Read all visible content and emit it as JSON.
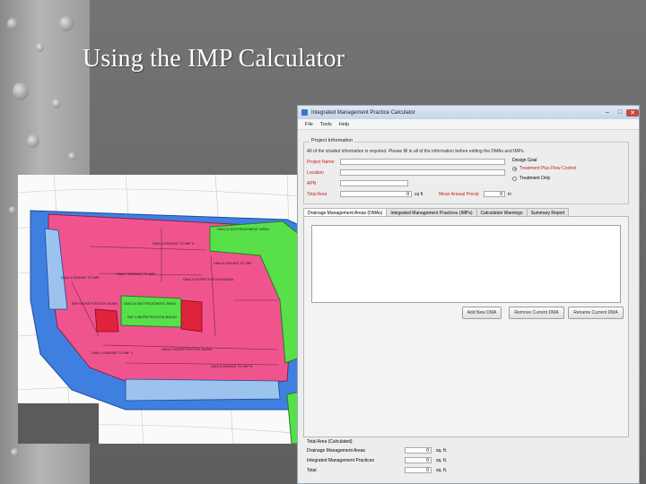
{
  "slide": {
    "title": "Using the IMP Calculator"
  },
  "map": {
    "labels": [
      "DMA 11 BIOTREATMENT AREA",
      "DMA 5 DRAINS TO IMP 5",
      "DMA 6 DRAINS TO IMP",
      "DMA 4 BIORETENTION BASIN",
      "DMA 3 DRAINS TO IMP",
      "DMA 7 DRAINS TO IMP",
      "DMA 10 BIOTREATMENT AREA",
      "IMP BIORETENTION BASIN",
      "IMP 3 BIORETENTION BASIN",
      "DMA 2 BIORETENTION BASIN",
      "DMA 8 DRAINS TO IMP 8",
      "DMA 1 DRAINS TO IMP 1"
    ]
  },
  "window": {
    "title": "Integrated Management Practice Calculator",
    "menu": [
      "File",
      "Tools",
      "Help"
    ],
    "project": {
      "group_title": "Project Information",
      "note": "All of the shaded information is required. Please fill in all of the information before editing the DMAs and IMPs.",
      "name_label": "Project Name:",
      "location_label": "Location",
      "apn_label": "APN",
      "total_area_label": "Total Area",
      "total_area_value": "0",
      "total_area_unit": "sq ft",
      "precip_label": "Mean Annual Precip",
      "precip_value": "0",
      "precip_unit": "in",
      "design_goal_label": "Design Goal",
      "goal_options": [
        "Treatment Plus Flow Control",
        "Treatment Only"
      ]
    },
    "tabs": [
      "Drainage Management Areas (DMAs)",
      "Integrated Management Practices (IMPs)",
      "Calculation Warnings",
      "Summary Report"
    ],
    "buttons": {
      "add": "Add New DMA",
      "remove": "Remove Current DMA",
      "rename": "Rename Current DMA"
    },
    "totals": {
      "title": "Total Area (Calculated)",
      "rows": [
        {
          "label": "Drainage Management Areas",
          "value": "0",
          "unit": "sq. ft."
        },
        {
          "label": "Integrated Management Practices",
          "value": "0",
          "unit": "sq. ft."
        },
        {
          "label": "Total",
          "value": "0",
          "unit": "sq. ft."
        }
      ]
    }
  }
}
